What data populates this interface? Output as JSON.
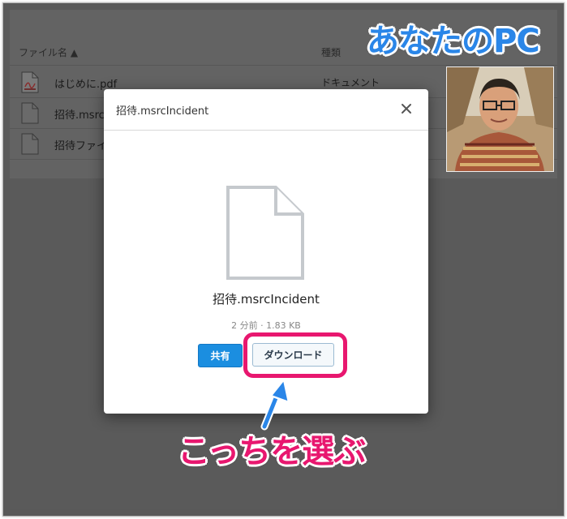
{
  "file_list": {
    "columns": {
      "name": "ファイル名 ▲",
      "type": "種類"
    },
    "rows": [
      {
        "name": "はじめに.pdf",
        "type": "ドキュメント",
        "icon": "pdf-file-icon"
      },
      {
        "name": "招待.msrc",
        "type": "",
        "icon": "file-icon"
      },
      {
        "name": "招待ファイル",
        "type": "",
        "icon": "file-icon"
      }
    ]
  },
  "modal": {
    "title": "招待.msrcIncident",
    "close_icon": "close-icon",
    "file_name": "招待.msrcIncident",
    "meta": "2 分前 · 1.83 KB",
    "share_label": "共有",
    "download_label": "ダウンロード"
  },
  "annotations": {
    "pc_label": "あなたのPC",
    "choose_label": "こっちを選ぶ",
    "highlight_color": "#e8176f",
    "label_blue": "#2a86e8"
  },
  "colors": {
    "primary_button": "#1b8ee0",
    "overlay": "#5a5a5a"
  }
}
